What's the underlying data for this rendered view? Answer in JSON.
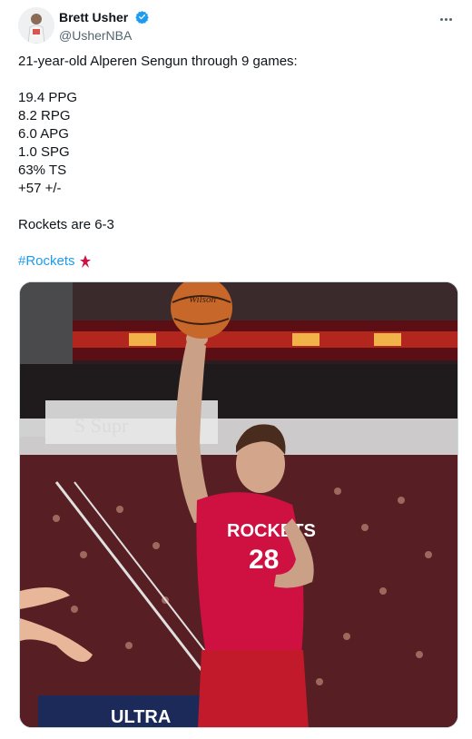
{
  "author": {
    "display_name": "Brett Usher",
    "handle": "@UsherNBA",
    "verified": true,
    "verified_color": "#1d9bf0"
  },
  "tweet": {
    "lines": [
      "21-year-old Alperen Sengun through 9 games:",
      "",
      "19.4 PPG",
      "8.2 RPG",
      "6.0 APG",
      "1.0 SPG",
      "63% TS",
      "+57 +/-",
      "",
      "Rockets are 6-3",
      ""
    ],
    "hashtag": "#Rockets",
    "hashtag_color": "#1d9bf0"
  },
  "media": {
    "jersey_team": "ROCKETS",
    "jersey_number": "28",
    "ball_brand": "Wilson",
    "banner_text": "ULTRA",
    "team_color": "#ce1141"
  }
}
